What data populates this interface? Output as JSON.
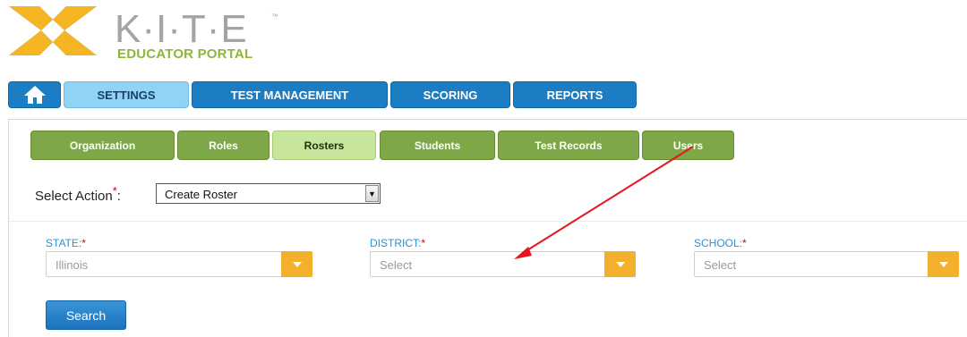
{
  "logo": {
    "brand": "K·I·T·E",
    "tm": "™",
    "subtitle": "EDUCATOR PORTAL",
    "colors": {
      "gray": "#a4a4a4",
      "green": "#8cb83a",
      "yellow": "#f5b523",
      "blue": "#4a8fd4"
    }
  },
  "nav": {
    "home_icon": "home-icon",
    "items": [
      {
        "label": "SETTINGS",
        "active": true
      },
      {
        "label": "TEST MANAGEMENT",
        "active": false
      },
      {
        "label": "SCORING",
        "active": false
      },
      {
        "label": "REPORTS",
        "active": false
      }
    ]
  },
  "subtabs": [
    {
      "label": "Organization",
      "active": false
    },
    {
      "label": "Roles",
      "active": false
    },
    {
      "label": "Rosters",
      "active": true
    },
    {
      "label": "Students",
      "active": false
    },
    {
      "label": "Test Records",
      "active": false
    },
    {
      "label": "Users",
      "active": false
    }
  ],
  "select_action": {
    "label": "Select Action",
    "required_mark": "*",
    "colon": ":",
    "value": "Create Roster"
  },
  "filters": {
    "state": {
      "label": "STATE:",
      "required_mark": "*",
      "value": "Illinois"
    },
    "district": {
      "label": "DISTRICT:",
      "required_mark": "*",
      "value": "Select"
    },
    "school": {
      "label": "SCHOOL:",
      "required_mark": "*",
      "value": "Select"
    }
  },
  "search_button": "Search",
  "annotation": {
    "type": "arrow",
    "color": "#e8141b"
  }
}
